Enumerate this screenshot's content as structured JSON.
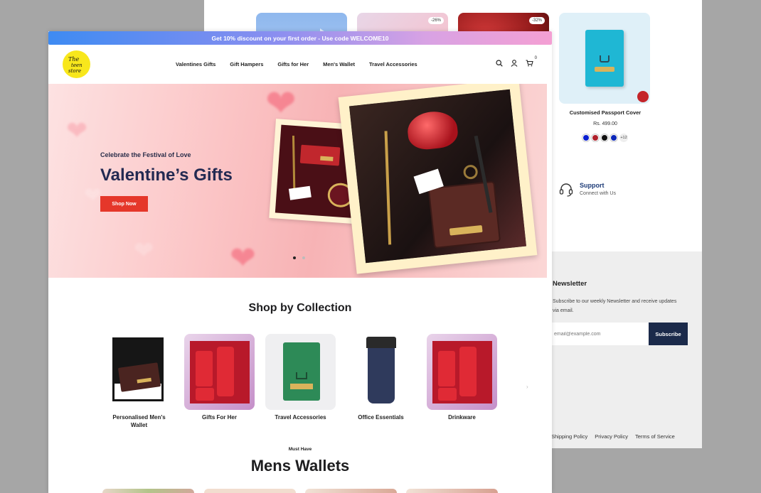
{
  "back_page": {
    "card_badges": [
      "-26%",
      "-32%"
    ],
    "passport": {
      "name": "Customised Passport Cover",
      "price": "Rs. 499.00",
      "more_colors": "+12",
      "swatches": [
        "#0a1fd1",
        "#b0222c",
        "#111111",
        "#0c26b8"
      ]
    },
    "support": {
      "title": "Support",
      "subtitle": "Connect with Us"
    },
    "newsletter": {
      "title": "Newsletter",
      "text": "Subscribe to our weekly Newsletter and receive updates via email.",
      "placeholder": "email@example.com",
      "button": "Subscribe"
    },
    "footer_links": [
      "Shipping Policy",
      "Privacy Policy",
      "Terms of Service"
    ]
  },
  "front_page": {
    "announcement": "Get 10% discount on your first order - Use code WELCOME10",
    "logo": {
      "text": "The Teen Store"
    },
    "nav": [
      "Valentines Gifts",
      "Gift Hampers",
      "Gifts for Her",
      "Men's Wallet",
      "Travel Accessories"
    ],
    "cart_count": "0",
    "hero": {
      "eyebrow": "Celebrate the Festival of Love",
      "title": "Valentine’s Gifts",
      "button": "Shop Now",
      "slides": 2,
      "active_slide": 1
    },
    "collections_title": "Shop by Collection",
    "collections": [
      {
        "label": "Personalised Men's Wallet"
      },
      {
        "label": "Gifts For Her"
      },
      {
        "label": "Travel Accessories"
      },
      {
        "label": "Office Essentials"
      },
      {
        "label": "Drinkware"
      }
    ],
    "must_have": {
      "eyebrow": "Must Have",
      "title": "Mens Wallets"
    }
  }
}
